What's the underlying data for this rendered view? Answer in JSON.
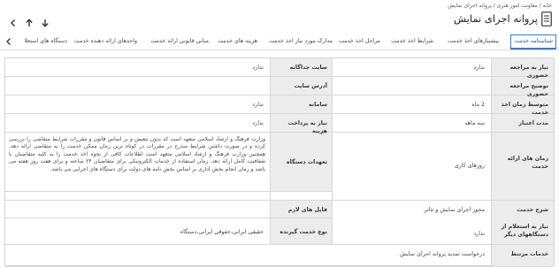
{
  "breadcrumb": "خانه / معاونت امور هنری / پروانه اجرای نمایش",
  "page_title": "پروانه اجرای نمایش",
  "tabs": [
    {
      "label": "شناسنامه خدمت",
      "active": true
    },
    {
      "label": "پیشنیازهای اخذ خدمت"
    },
    {
      "label": "شرایط اخذ خدمت"
    },
    {
      "label": "مراحل اخذ خدمت"
    },
    {
      "label": "مدارک مورد نیاز اخذ خدمت"
    },
    {
      "label": "هزینه های خدمت"
    },
    {
      "label": "مبانی قانونی ارائه خدمت"
    },
    {
      "label": "واحدهای ارائه دهنده خدمت"
    },
    {
      "label": "دستگاه های استعلا"
    }
  ],
  "fields": {
    "visit_needed": {
      "label": "نیاز به مراجعه حضوری",
      "value": "ندارد"
    },
    "separate_site": {
      "label": "سایت جداگانه",
      "value": "ندارد"
    },
    "visit_explanation": {
      "label": "توضیح مراجعه حضوری",
      "value": ""
    },
    "site_address": {
      "label": "آدرس سایت",
      "value": ""
    },
    "avg_time": {
      "label": "متوسط زمان اخذ خدمت",
      "value": "2 ماه"
    },
    "system": {
      "label": "سامانه",
      "value": "ندارد"
    },
    "validity": {
      "label": "مدت اعتبار",
      "value": "سه ماهه"
    },
    "payment_needed": {
      "label": "نیاز به پرداخت هزینه",
      "value": "ندارد"
    },
    "service_times": {
      "label": "زمان های ارائه خدمت",
      "value": "روزهای کاری"
    },
    "commitments": {
      "label": "تعهدات دستگاه",
      "value": "وزارت فرهنگ و ارشاد اسلامی متعهد است که بدون تبعیض و بر اساس قانون و مقررات شرایط متقاضی را بررسی کرده و در صورت داشتن شرایط مندرج در مقررات در کوتاه ترین زمان ممکن خدمت را به متقاضی ارائه دهد. همچنین وزارت فرهنگ و ارشاد اسلامی متعهد است اطلاعات کافی از نحوه اخذ خدمت را به کلیه متقاضیان با شفافیت کامل ارائه دهد. زمان استفاده از خدمات الکترونیکی برای متقاضیان ۲۴ ساعته و برای هفت روز هفته می باشد و زمان انجام بخش اداری بر اساس بخش نامه های دولت برای دستگاه های اجرایی می باشد."
    },
    "service_desc": {
      "label": "شرح خدمت",
      "value": "مجوز اجرای نمایش و تئاتر"
    },
    "required_files": {
      "label": "فایل های لازم",
      "value": ""
    },
    "inquiry_needed": {
      "label": "نیاز به استعلام از دستگاههای دیگر",
      "value": "ندارد"
    },
    "recipient_type": {
      "label": "نوع خدمت گیرنده",
      "value": "حقیقی ایرانی،حقوقی ایرانی،دستگاه"
    },
    "related_services": {
      "label": "خدمات مرتبط",
      "value": "درخواست تمدید پروانه اجرای نمایش"
    }
  }
}
